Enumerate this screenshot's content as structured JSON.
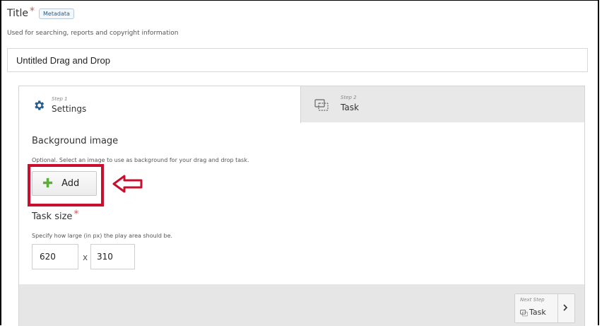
{
  "title": {
    "label": "Title",
    "required_mark": "*",
    "metadata_button": "Metadata",
    "description": "Used for searching, reports and copyright information",
    "value": "Untitled Drag and Drop"
  },
  "tabs": [
    {
      "step": "Step 1",
      "name": "Settings",
      "icon": "gear-icon",
      "active": true
    },
    {
      "step": "Step 2",
      "name": "Task",
      "icon": "task-icon",
      "active": false
    }
  ],
  "background_image": {
    "title": "Background image",
    "help": "Optional. Select an image to use as background for your drag and drop task.",
    "add_button": "Add"
  },
  "task_size": {
    "title": "Task size",
    "required_mark": "*",
    "help": "Specify how large (in px) the play area should be.",
    "width": "620",
    "separator": "x",
    "height": "310"
  },
  "next_step": {
    "label": "Next Step",
    "target": "Task"
  },
  "colors": {
    "accent_required": "#d9534f",
    "highlight": "#c8102e",
    "gear": "#2b5d8a",
    "plus": "#5cae3b"
  }
}
